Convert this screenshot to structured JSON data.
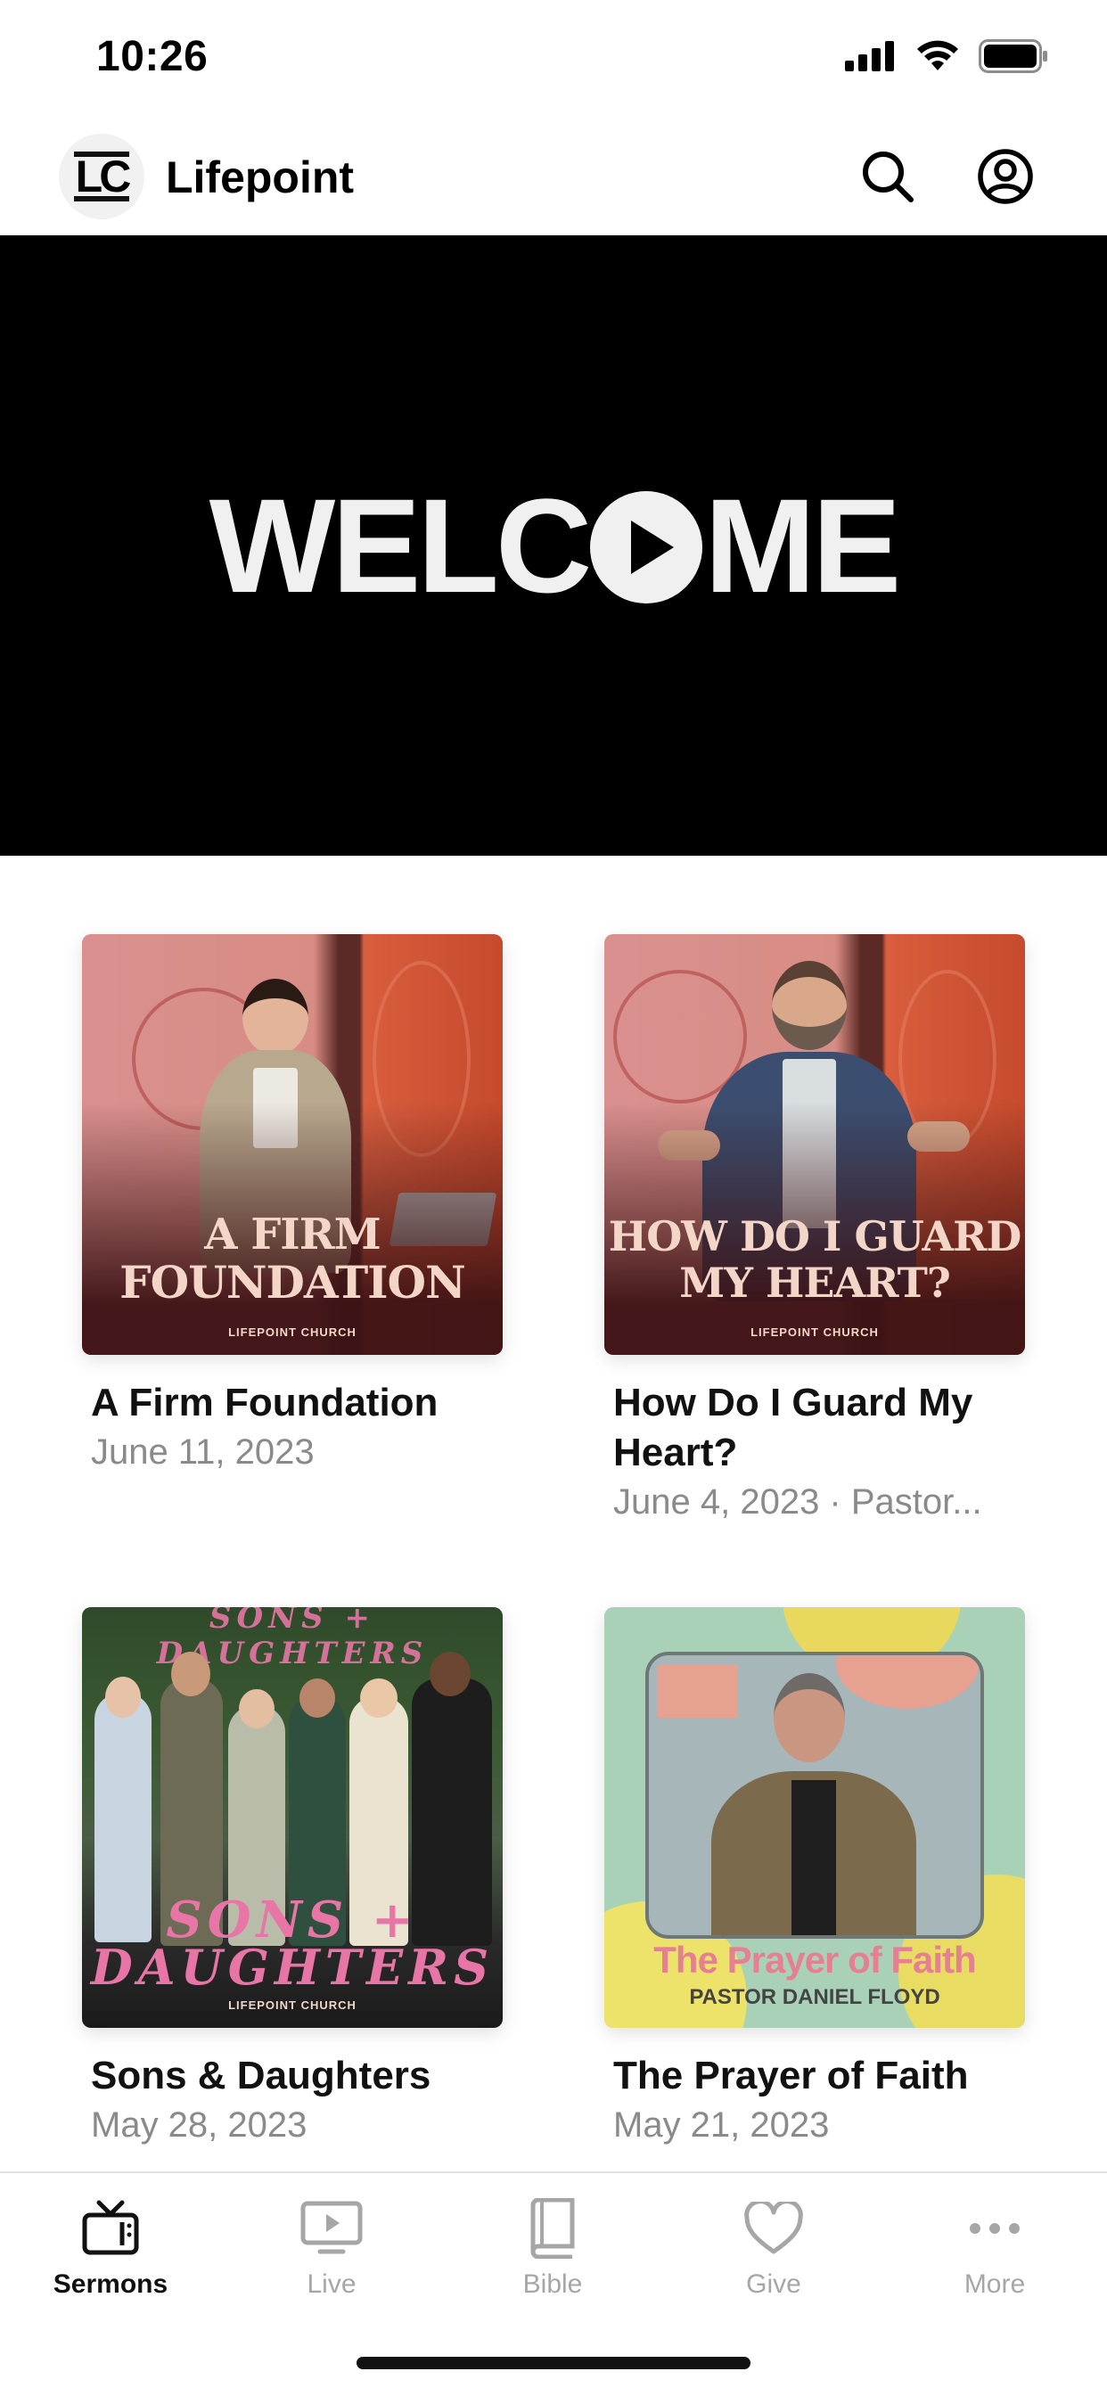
{
  "status": {
    "time": "10:26"
  },
  "header": {
    "title": "Lifepoint",
    "logo_text": "LC"
  },
  "hero": {
    "text_before": "WELC",
    "text_after": "ME"
  },
  "sermons": [
    {
      "title": "A Firm Foundation",
      "meta": "June 11, 2023",
      "art_title_line1": "A FIRM",
      "art_title_line2": "FOUNDATION",
      "art_brand": "LIFEPOINT CHURCH"
    },
    {
      "title": "How Do I Guard My Heart?",
      "meta": "June 4, 2023 · Pastor...",
      "art_title_line1": "HOW DO I GUARD",
      "art_title_line2": "MY HEART?",
      "art_brand": "LIFEPOINT CHURCH"
    },
    {
      "title": "Sons & Daughters",
      "meta": "May 28, 2023",
      "art_top": "SONS + DAUGHTERS",
      "art_line1": "SONS +",
      "art_line2": "DAUGHTERS",
      "art_brand": "LIFEPOINT CHURCH"
    },
    {
      "title": "The Prayer of Faith",
      "meta": "May 21, 2023",
      "art_title": "The Prayer of Faith",
      "art_sub": "PASTOR DANIEL FLOYD"
    }
  ],
  "tabs": [
    {
      "label": "Sermons",
      "icon": "tv-icon",
      "active": true
    },
    {
      "label": "Live",
      "icon": "play-screen-icon",
      "active": false
    },
    {
      "label": "Bible",
      "icon": "book-icon",
      "active": false
    },
    {
      "label": "Give",
      "icon": "heart-icon",
      "active": false
    },
    {
      "label": "More",
      "icon": "more-dots-icon",
      "active": false
    }
  ],
  "colors": {
    "accent": "#000000",
    "inactive_tab": "#a6a6a6",
    "meta_text": "#8a8a8a"
  }
}
